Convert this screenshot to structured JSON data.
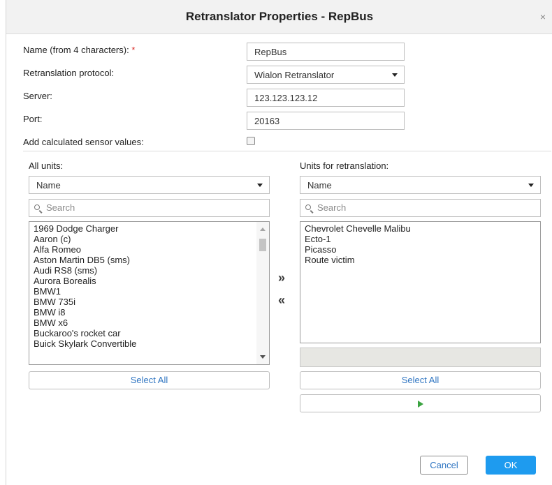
{
  "dialog": {
    "title": "Retranslator Properties - RepBus",
    "close_glyph": "×"
  },
  "form": {
    "name_label": "Name (from 4 characters):",
    "required_mark": "*",
    "name_value": "RepBus",
    "protocol_label": "Retranslation protocol:",
    "protocol_value": "Wialon Retranslator",
    "server_label": "Server:",
    "server_value": "123.123.123.12",
    "port_label": "Port:",
    "port_value": "20163",
    "calc_label": "Add calculated sensor values:",
    "calc_checked": false
  },
  "all_units": {
    "label": "All units:",
    "sort_value": "Name",
    "search_placeholder": "Search",
    "items": [
      "1969 Dodge Charger",
      "Aaron (c)",
      "Alfa Romeo",
      "Aston Martin DB5 (sms)",
      "Audi RS8 (sms)",
      "Aurora Borealis",
      "BMW1",
      "BMW 735i",
      "BMW i8",
      "BMW x6",
      "Buckaroo's rocket car",
      "Buick Skylark Convertible"
    ],
    "select_all": "Select All"
  },
  "transfer": {
    "add_glyph": "»",
    "remove_glyph": "«"
  },
  "retrans_units": {
    "label": "Units for retranslation:",
    "sort_value": "Name",
    "search_placeholder": "Search",
    "items": [
      "Chevrolet Chevelle Malibu",
      "Ecto-1",
      "Picasso",
      "Route victim"
    ],
    "select_all": "Select All"
  },
  "footer": {
    "cancel": "Cancel",
    "ok": "OK"
  },
  "colors": {
    "accent": "#1e9bef",
    "link": "#3076c2",
    "required": "#d9302c",
    "play": "#3aa340"
  },
  "icons": {
    "close": "close-icon",
    "search": "search-icon",
    "caret": "chevron-down-icon",
    "play": "play-icon"
  }
}
